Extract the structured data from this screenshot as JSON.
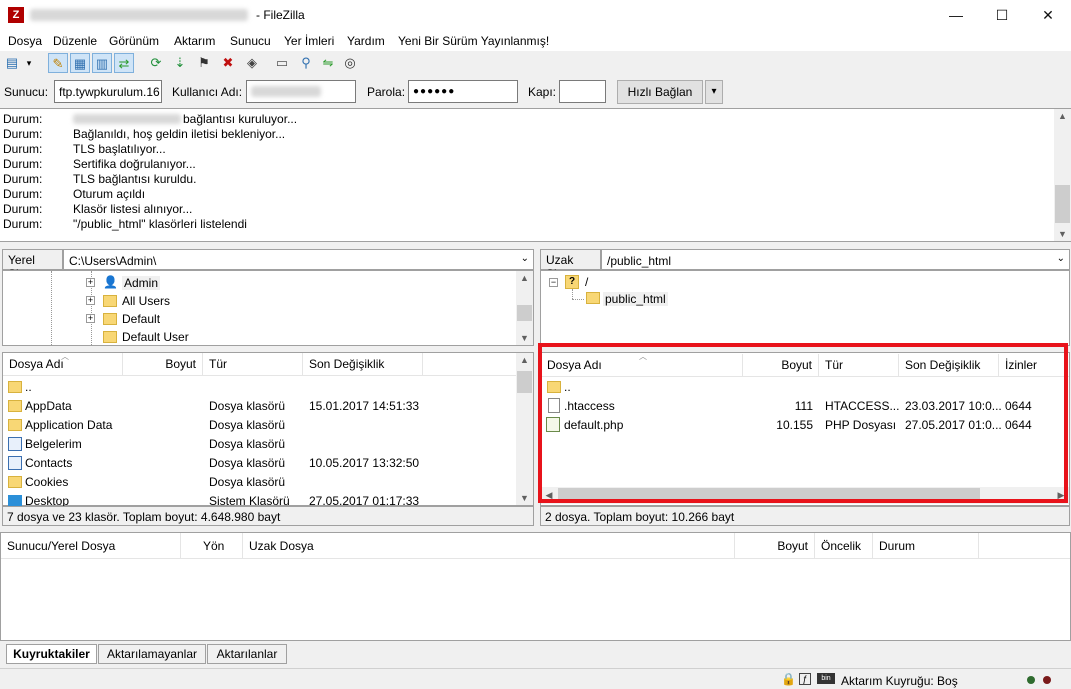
{
  "window": {
    "app_title": "FileZilla",
    "app_title_prefix": "- FileZilla",
    "controls": {
      "minimize": "—",
      "maximize": "☐",
      "close": "✕"
    }
  },
  "menu": [
    "Dosya",
    "Düzenle",
    "Görünüm",
    "Aktarım",
    "Sunucu",
    "Yer İmleri",
    "Yardım",
    "Yeni Bir Sürüm Yayınlanmış!"
  ],
  "quickconnect": {
    "host_label": "Sunucu:",
    "host_value": "ftp.tywpkurulum.16",
    "user_label": "Kullanıcı Adı:",
    "pass_label": "Parola:",
    "pass_value": "●●●●●●",
    "port_label": "Kapı:",
    "port_value": "",
    "connect_label": "Hızlı Bağlan",
    "dropdown": "▾"
  },
  "log": [
    {
      "k": "Durum:",
      "v": "bağlantısı kuruluyor..."
    },
    {
      "k": "Durum:",
      "v": "Bağlanıldı, hoş geldin iletisi bekleniyor..."
    },
    {
      "k": "Durum:",
      "v": "TLS başlatılıyor..."
    },
    {
      "k": "Durum:",
      "v": "Sertifika doğrulanıyor..."
    },
    {
      "k": "Durum:",
      "v": "TLS bağlantısı kuruldu."
    },
    {
      "k": "Durum:",
      "v": "Oturum açıldı"
    },
    {
      "k": "Durum:",
      "v": "Klasör listesi alınıyor..."
    },
    {
      "k": "Durum:",
      "v": "\"/public_html\" klasörleri listelendi"
    }
  ],
  "local": {
    "site_label": "Yerel Site:",
    "path": "C:\\Users\\Admin\\",
    "tree": [
      "Admin",
      "All Users",
      "Default",
      "Default User"
    ],
    "columns": [
      "Dosya Adı",
      "Boyut",
      "Tür",
      "Son Değişiklik"
    ],
    "files": [
      {
        "name": "..",
        "size": "",
        "type": "",
        "modified": ""
      },
      {
        "name": "AppData",
        "size": "",
        "type": "Dosya klasörü",
        "modified": "15.01.2017 14:51:33"
      },
      {
        "name": "Application Data",
        "size": "",
        "type": "Dosya klasörü",
        "modified": ""
      },
      {
        "name": "Belgelerim",
        "size": "",
        "type": "Dosya klasörü",
        "modified": ""
      },
      {
        "name": "Contacts",
        "size": "",
        "type": "Dosya klasörü",
        "modified": "10.05.2017 13:32:50"
      },
      {
        "name": "Cookies",
        "size": "",
        "type": "Dosya klasörü",
        "modified": ""
      },
      {
        "name": "Desktop",
        "size": "",
        "type": "Sistem Klasörü",
        "modified": "27.05.2017 01:17:33"
      }
    ],
    "status": "7 dosya ve 23 klasör. Toplam boyut: 4.648.980 bayt"
  },
  "remote": {
    "site_label": "Uzak Site:",
    "path": "/public_html",
    "tree_root": "/",
    "tree": [
      "public_html"
    ],
    "columns": [
      "Dosya Adı",
      "Boyut",
      "Tür",
      "Son Değişiklik",
      "İzinler"
    ],
    "files": [
      {
        "name": "..",
        "size": "",
        "type": "",
        "modified": "",
        "perm": ""
      },
      {
        "name": ".htaccess",
        "size": "111",
        "type": "HTACCESS...",
        "modified": "23.03.2017 10:0...",
        "perm": "0644"
      },
      {
        "name": "default.php",
        "size": "10.155",
        "type": "PHP Dosyası",
        "modified": "27.05.2017 01:0...",
        "perm": "0644"
      }
    ],
    "status": "2 dosya. Toplam boyut: 10.266 bayt",
    "highlight_color": "#e8131b"
  },
  "queue": {
    "columns": [
      "Sunucu/Yerel Dosya",
      "Yön",
      "Uzak Dosya",
      "Boyut",
      "Öncelik",
      "Durum"
    ],
    "tabs": [
      "Kuyruktakiler",
      "Aktarılamayanlar",
      "Aktarılanlar"
    ]
  },
  "statusbar": {
    "queue_text": "Aktarım Kuyruğu: Boş"
  }
}
